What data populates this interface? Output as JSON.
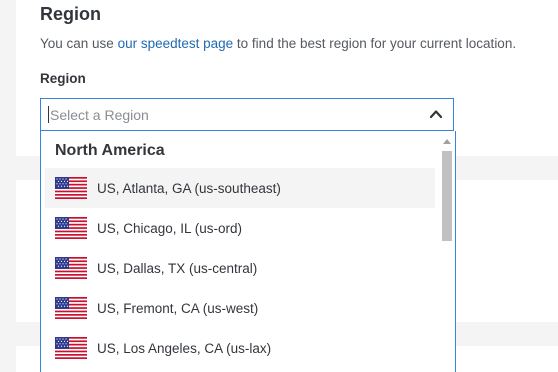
{
  "section": {
    "title": "Region",
    "description_before": "You can use ",
    "description_link": "our speedtest page",
    "description_after": " to find the best region for your current location."
  },
  "field": {
    "label": "Region",
    "placeholder": "Select a Region",
    "value": ""
  },
  "dropdown": {
    "group_label": "North America",
    "options": [
      {
        "label": "US, Atlanta, GA (us-southeast)",
        "flag": "us-flag-icon",
        "hovered": true
      },
      {
        "label": "US, Chicago, IL (us-ord)",
        "flag": "us-flag-icon",
        "hovered": false
      },
      {
        "label": "US, Dallas, TX (us-central)",
        "flag": "us-flag-icon",
        "hovered": false
      },
      {
        "label": "US, Fremont, CA (us-west)",
        "flag": "us-flag-icon",
        "hovered": false
      },
      {
        "label": "US, Los Angeles, CA (us-lax)",
        "flag": "us-flag-icon",
        "hovered": false
      }
    ]
  },
  "colors": {
    "link": "#1f6ab2",
    "focus_border": "#3683dc",
    "text": "#32363b",
    "hover_bg": "#f4f4f4"
  }
}
